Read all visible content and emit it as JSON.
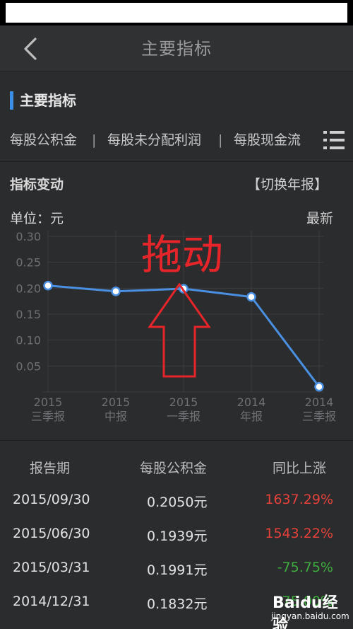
{
  "nav": {
    "title": "主要指标"
  },
  "section": {
    "title": "主要指标"
  },
  "tabs": [
    {
      "label": "每股公积金"
    },
    {
      "label": "每股未分配利润"
    },
    {
      "label": "每股现金流"
    }
  ],
  "tab_separator": "|",
  "chart_header": {
    "title": "指标变动",
    "switch_label": "【切换年报】",
    "unit_label": "单位：元",
    "latest_label": "最新"
  },
  "annotation": {
    "text": "拖动",
    "color": "#e5252a"
  },
  "chart_data": {
    "type": "line",
    "y_ticks": [
      "0.05",
      "0.10",
      "0.15",
      "0.20",
      "0.25",
      "0.30"
    ],
    "ylim": [
      0,
      0.3
    ],
    "categories": [
      {
        "year": "2015",
        "period": "三季报"
      },
      {
        "year": "2015",
        "period": "中报"
      },
      {
        "year": "2015",
        "period": "一季报"
      },
      {
        "year": "2014",
        "period": "年报"
      },
      {
        "year": "2014",
        "period": "三季报"
      }
    ],
    "series": [
      {
        "values": [
          0.205,
          0.1939,
          0.1991,
          0.1832,
          0.01
        ],
        "color": "#4a90e2"
      }
    ],
    "grid": true
  },
  "table": {
    "headers": [
      "报告期",
      "每股公积金",
      "同比上涨"
    ],
    "rows": [
      {
        "date": "2015/09/30",
        "value": "0.2050元",
        "change": "1637.29%",
        "dir": "up"
      },
      {
        "date": "2015/06/30",
        "value": "0.1939元",
        "change": "1543.22%",
        "dir": "up"
      },
      {
        "date": "2015/03/31",
        "value": "0.1991元",
        "change": "-75.75%",
        "dir": "down"
      },
      {
        "date": "2014/12/31",
        "value": "0.1832元",
        "change": "-75.00%",
        "dir": "down"
      }
    ]
  },
  "watermark": {
    "logo": "Baidu经验",
    "url": "jingyan.baidu.com"
  }
}
